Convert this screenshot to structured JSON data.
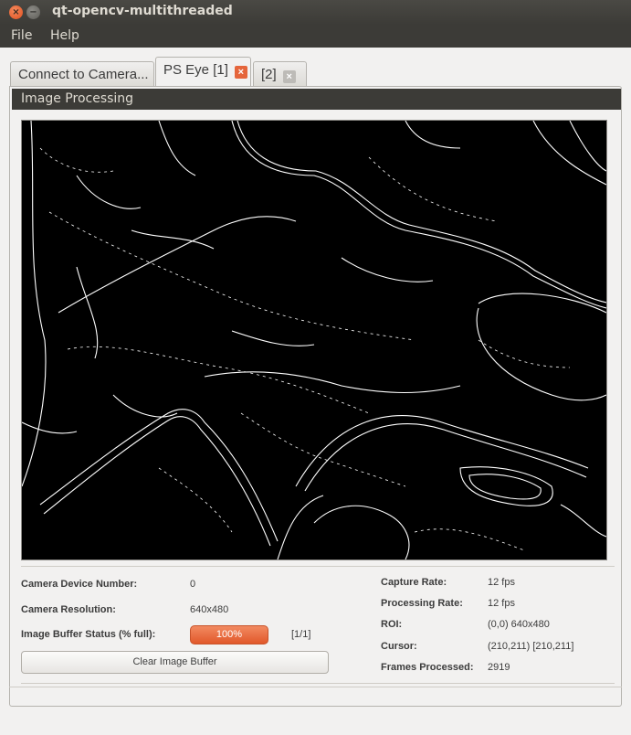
{
  "window": {
    "title": "qt-opencv-multithreaded",
    "close_glyph": "×",
    "min_glyph": "−"
  },
  "menu": {
    "file": "File",
    "help": "Help"
  },
  "tabs": [
    {
      "label": "Connect to Camera..."
    },
    {
      "label": "PS Eye [1]",
      "close_icon": "close-icon",
      "close_color": "#e5653b"
    },
    {
      "label": "[2]",
      "close_icon": "close-icon",
      "close_color": "#bdbbb7"
    }
  ],
  "group": {
    "title": "Image Processing"
  },
  "info": {
    "device_number_label": "Camera Device Number:",
    "device_number": "0",
    "resolution_label": "Camera Resolution:",
    "resolution": "640x480",
    "buffer_label": "Image Buffer Status (% full):",
    "buffer_percent": "100%",
    "buffer_fraction": 1.0,
    "buffer_count": "[1/1]",
    "clear_button": "Clear Image Buffer",
    "capture_rate_label": "Capture Rate:",
    "capture_rate": "12 fps",
    "processing_rate_label": "Processing Rate:",
    "processing_rate": "12 fps",
    "roi_label": "ROI:",
    "roi": "(0,0) 640x480",
    "cursor_label": "Cursor:",
    "cursor": "(210,211) [210,211]",
    "frames_label": "Frames Processed:",
    "frames": "2919"
  },
  "colors": {
    "accent": "#e5653b",
    "titlebar": "#3c3b37",
    "frame_bg": "#000000"
  }
}
